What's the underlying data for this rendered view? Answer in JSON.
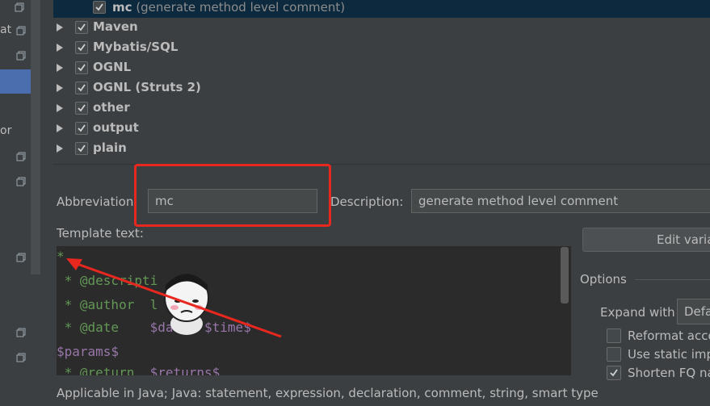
{
  "tree": {
    "selected_item": {
      "label": "mc",
      "description": "(generate method level comment)"
    },
    "groups": [
      {
        "label": "Maven"
      },
      {
        "label": "Mybatis/SQL"
      },
      {
        "label": "OGNL"
      },
      {
        "label": "OGNL (Struts 2)"
      },
      {
        "label": "other"
      },
      {
        "label": "output"
      },
      {
        "label": "plain"
      }
    ]
  },
  "left_strip": {
    "fragments": [
      "at",
      "or"
    ]
  },
  "form": {
    "abbreviation_label": "Abbreviation:",
    "abbreviation_value": "mc",
    "description_label": "Description:",
    "description_value": "generate method level comment",
    "template_label": "Template text:",
    "edit_variables_label": "Edit varia",
    "applicable_text": "Applicable in Java; Java: statement, expression, declaration, comment, string, smart type"
  },
  "template_code": {
    "lines": [
      {
        "text": "*",
        "var": ""
      },
      {
        "text": " * @descripti",
        "var": ""
      },
      {
        "text": " * @author  l",
        "var": ""
      },
      {
        "text": " * @date    ",
        "var": "$date$ $time$"
      },
      {
        "text": "",
        "var": "$params$"
      },
      {
        "text": " * @return  ",
        "var": "$returns$"
      }
    ]
  },
  "options": {
    "title": "Options",
    "expand_with_label": "Expand with",
    "expand_with_value": "Defa",
    "reformat_label": "Reformat acco",
    "static_import_label": "Use static imp",
    "shorten_fq_label": "Shorten FQ na",
    "reformat_checked": false,
    "static_import_checked": false,
    "shorten_fq_checked": true
  },
  "colors": {
    "highlight_border": "#e8271f",
    "arrow": "#e8271f",
    "selection": "#0d293e",
    "accent": "#4b6eaf"
  }
}
